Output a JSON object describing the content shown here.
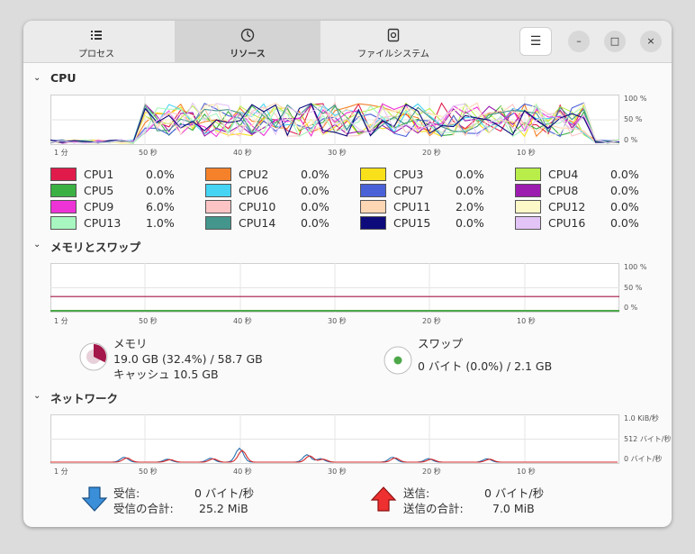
{
  "tabs": [
    {
      "label": "プロセス",
      "icon": "list-icon"
    },
    {
      "label": "リソース",
      "icon": "gauge-icon"
    },
    {
      "label": "ファイルシステム",
      "icon": "disk-icon"
    }
  ],
  "window_buttons": {
    "minimize": "–",
    "maximize": "□",
    "close": "×",
    "menu": "☰"
  },
  "cpu": {
    "title": "CPU",
    "y_ticks": [
      "100 %",
      "50 %",
      "0 %"
    ],
    "x_ticks": [
      "1 分",
      "50 秒",
      "40 秒",
      "30 秒",
      "20 秒",
      "10 秒"
    ],
    "items": [
      {
        "name": "CPU1",
        "value": "0.0%",
        "color": "#e01b4b"
      },
      {
        "name": "CPU2",
        "value": "0.0%",
        "color": "#f5822a"
      },
      {
        "name": "CPU3",
        "value": "0.0%",
        "color": "#f8e11a"
      },
      {
        "name": "CPU4",
        "value": "0.0%",
        "color": "#b9ee4a"
      },
      {
        "name": "CPU5",
        "value": "0.0%",
        "color": "#3bb143"
      },
      {
        "name": "CPU6",
        "value": "0.0%",
        "color": "#45d4f4"
      },
      {
        "name": "CPU7",
        "value": "0.0%",
        "color": "#4a62d8"
      },
      {
        "name": "CPU8",
        "value": "0.0%",
        "color": "#9b1cae"
      },
      {
        "name": "CPU9",
        "value": "6.0%",
        "color": "#ee33d6"
      },
      {
        "name": "CPU10",
        "value": "0.0%",
        "color": "#fcc4c4"
      },
      {
        "name": "CPU11",
        "value": "2.0%",
        "color": "#fdd6b4"
      },
      {
        "name": "CPU12",
        "value": "0.0%",
        "color": "#fdf8c8"
      },
      {
        "name": "CPU13",
        "value": "1.0%",
        "color": "#a8f7c0"
      },
      {
        "name": "CPU14",
        "value": "0.0%",
        "color": "#44968c"
      },
      {
        "name": "CPU15",
        "value": "0.0%",
        "color": "#0d0a7c"
      },
      {
        "name": "CPU16",
        "value": "0.0%",
        "color": "#e3c4f6"
      }
    ]
  },
  "memory": {
    "title": "メモリとスワップ",
    "y_ticks": [
      "100 %",
      "50 %",
      "0 %"
    ],
    "x_ticks": [
      "1 分",
      "50 秒",
      "40 秒",
      "30 秒",
      "20 秒",
      "10 秒"
    ],
    "mem_label": "メモリ",
    "mem_usage": "19.0 GB (32.4%) / 58.7 GB",
    "cache": "キャッシュ 10.5 GB",
    "mem_color": "#a3174a",
    "mem_percent": 32.4,
    "swap_label": "スワップ",
    "swap_usage": "0 バイト (0.0%) / 2.1 GB",
    "swap_color": "#4ea84a"
  },
  "network": {
    "title": "ネットワーク",
    "y_ticks": [
      "1.0 KiB/秒",
      "512 バイト/秒",
      "0 バイト/秒"
    ],
    "x_ticks": [
      "1 分",
      "50 秒",
      "40 秒",
      "30 秒",
      "20 秒",
      "10 秒"
    ],
    "recv_label": "受信:",
    "recv_rate": "0 バイト/秒",
    "recv_total_label": "受信の合計:",
    "recv_total": "25.2 MiB",
    "send_label": "送信:",
    "send_rate": "0 バイト/秒",
    "send_total_label": "送信の合計:",
    "send_total": "7.0 MiB",
    "recv_color": "#2a6fb0",
    "send_color": "#d42a2a"
  }
}
